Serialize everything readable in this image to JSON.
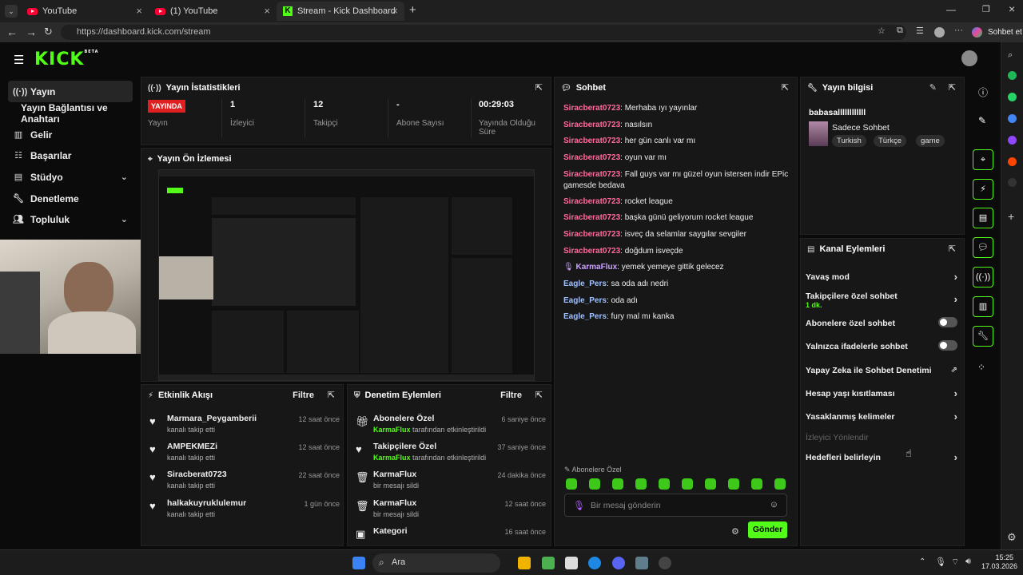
{
  "browser": {
    "tabs": [
      {
        "label": "YouTube"
      },
      {
        "label": "(1) YouTube"
      },
      {
        "label": "Stream - Kick Dashboard"
      }
    ],
    "url": "https://dashboard.kick.com/stream",
    "copilot_label": "Sohbet et"
  },
  "kick": {
    "logo": "KICK",
    "beta": "BETA"
  },
  "sidebar": {
    "items": [
      {
        "label": "Yayın",
        "icon": "live-icon"
      },
      {
        "label": "Yayın Bağlantısı ve Anahtarı"
      },
      {
        "label": "Gelir",
        "icon": "chart-icon"
      },
      {
        "label": "Başarılar",
        "icon": "list-icon"
      },
      {
        "label": "Stüdyo",
        "icon": "studio-icon"
      },
      {
        "label": "Denetleme",
        "icon": "wrench-icon"
      },
      {
        "label": "Topluluk",
        "icon": "people-icon"
      }
    ]
  },
  "stats": {
    "title": "Yayın İstatistikleri",
    "live_badge": "YAYINDA",
    "items": [
      {
        "value": "",
        "label": "Yayın"
      },
      {
        "value": "1",
        "label": "İzleyici"
      },
      {
        "value": "12",
        "label": "Takipçi"
      },
      {
        "value": "-",
        "label": "Abone Sayısı"
      },
      {
        "value": "00:29:03",
        "label": "Yayında Olduğu Süre"
      }
    ]
  },
  "preview": {
    "title": "Yayın Ön İzlemesi"
  },
  "activity": {
    "title": "Etkinlik Akışı",
    "filter": "Filtre",
    "items": [
      {
        "name": "Marmara_Peygamberii",
        "sub": "kanalı takip etti",
        "time": "12 saat önce"
      },
      {
        "name": "AMPEKMEZi",
        "sub": "kanalı takip etti",
        "time": "12 saat önce"
      },
      {
        "name": "Siracberat0723",
        "sub": "kanalı takip etti",
        "time": "22 saat önce"
      },
      {
        "name": "halkakuyruklulemur",
        "sub": "kanalı takip etti",
        "time": "1 gün önce"
      }
    ]
  },
  "moderation": {
    "title": "Denetim Eylemleri",
    "filter": "Filtre",
    "items": [
      {
        "name": "Abonelere Özel",
        "who": "KarmaFlux",
        "sub": " tarafından etkinleştirildi",
        "time": "6 saniye önce"
      },
      {
        "name": "Takipçilere Özel",
        "who": "KarmaFlux",
        "sub": " tarafından etkinleştirildi",
        "time": "37 saniye önce"
      },
      {
        "name": "KarmaFlux",
        "who": "",
        "sub": "bir mesajı sildi",
        "time": "24 dakika önce"
      },
      {
        "name": "KarmaFlux",
        "who": "",
        "sub": "bir mesajı sildi",
        "time": "12 saat önce"
      },
      {
        "name": "Kategori",
        "who": "",
        "sub": "",
        "time": "16 saat önce"
      }
    ]
  },
  "chat": {
    "title": "Sohbet",
    "messages": [
      {
        "user": "Siracberat0723",
        "text": ": Merhaba ıyı yayınlar",
        "color": "#ff6b9a"
      },
      {
        "user": "Siracberat0723",
        "text": ": nasılsın",
        "color": "#ff6b9a"
      },
      {
        "user": "Siracberat0723",
        "text": ": her gün canlı var mı",
        "color": "#ff6b9a"
      },
      {
        "user": "Siracberat0723",
        "text": ": oyun var mı",
        "color": "#ff6b9a"
      },
      {
        "user": "Siracberat0723",
        "text": ": Fall guys var mı güzel oyun istersen indir EPic gamesde bedava",
        "color": "#ff6b9a"
      },
      {
        "user": "Siracberat0723",
        "text": ": rocket league",
        "color": "#ff6b9a"
      },
      {
        "user": "Siracberat0723",
        "text": ": başka günü geliyorum rocket league",
        "color": "#ff6b9a"
      },
      {
        "user": "Siracberat0723",
        "text": ": isveç da selamlar saygılar sevgiler",
        "color": "#ff6b9a"
      },
      {
        "user": "Siracberat0723",
        "text": ": doğdum isveçde",
        "color": "#ff6b9a"
      },
      {
        "user": "KarmaFlux",
        "text": ": yemek yemeye gittik gelecez",
        "color": "#c9a0ff"
      },
      {
        "user": "Eagle_Pers",
        "text": ": sa oda adı nedri",
        "color": "#9fc0ff"
      },
      {
        "user": "Eagle_Pers",
        "text": ": oda adı",
        "color": "#9fc0ff"
      },
      {
        "user": "Eagle_Pers",
        "text": ": fury mal mı kanka",
        "color": "#9fc0ff"
      }
    ],
    "mode_label": "Abonelere Özel",
    "input_placeholder": "Bir mesaj gönderin",
    "send": "Gönder"
  },
  "info": {
    "title": "Yayın bilgisi",
    "stream_title": "babasallllllllllll",
    "category": "Sadece Sohbet",
    "tags": [
      "Turkish",
      "Türkçe",
      "game"
    ]
  },
  "actions": {
    "title": "Kanal Eylemleri",
    "items": [
      {
        "label": "Yavaş mod"
      },
      {
        "label": "Takipçilere özel sohbet",
        "sub": "1 dk."
      },
      {
        "label": "Abonelere özel sohbet"
      },
      {
        "label": "Yalnızca ifadelerle sohbet"
      },
      {
        "label": "Yapay Zeka ile Sohbet Denetimi"
      },
      {
        "label": "Hesap yaşı kısıtlaması"
      },
      {
        "label": "Yasaklanmış kelimeler"
      },
      {
        "label": "İzleyici Yönlendir"
      },
      {
        "label": "Hedefleri belirleyin"
      }
    ]
  },
  "taskbar": {
    "search": "Ara",
    "time": "15:25",
    "date": "17.03.2026"
  },
  "colors": {
    "accent": "#53fc18",
    "live": "#e02020"
  }
}
